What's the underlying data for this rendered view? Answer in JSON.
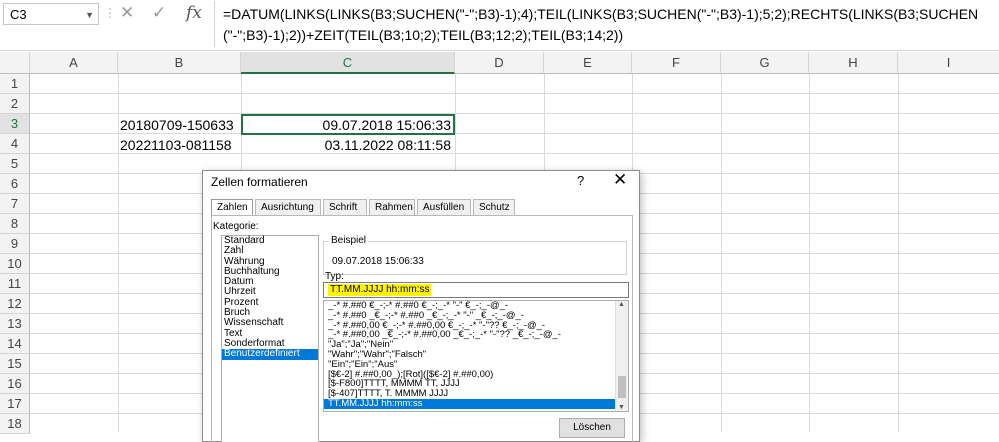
{
  "formula_bar": {
    "name_box": "C3",
    "formula": "=DATUM(LINKS(LINKS(B3;SUCHEN(\"-\";B3)-1);4);TEIL(LINKS(B3;SUCHEN(\"-\";B3)-1);5;2);RECHTS(LINKS(B3;SUCHEN(\"-\";B3)-1);2))+ZEIT(TEIL(B3;10;2);TEIL(B3;12;2);TEIL(B3;14;2))"
  },
  "columns": [
    "A",
    "B",
    "C",
    "D",
    "E",
    "F",
    "G",
    "H",
    "I"
  ],
  "rows": [
    "1",
    "2",
    "3",
    "4",
    "5",
    "6",
    "7",
    "8",
    "9",
    "10",
    "11",
    "12",
    "13",
    "14",
    "15",
    "16",
    "17",
    "18"
  ],
  "cells": {
    "B3": "20180709-150633",
    "C3": "09.07.2018 15:06:33",
    "B4": "20221103-081158",
    "C4": "03.11.2022 08:11:58"
  },
  "dialog": {
    "title": "Zellen formatieren",
    "help": "?",
    "close": "✕",
    "tabs": [
      "Zahlen",
      "Ausrichtung",
      "Schrift",
      "Rahmen",
      "Ausfüllen",
      "Schutz"
    ],
    "kategorie_label": "Kategorie:",
    "kategorien": [
      "Standard",
      "Zahl",
      "Währung",
      "Buchhaltung",
      "Datum",
      "Uhrzeit",
      "Prozent",
      "Bruch",
      "Wissenschaft",
      "Text",
      "Sonderformat",
      "Benutzerdefiniert"
    ],
    "selected_kategorie": "Benutzerdefiniert",
    "beispiel_label": "Beispiel",
    "beispiel_value": "09.07.2018 15:06:33",
    "typ_label": "Typ:",
    "typ_value": "TT.MM.JJJJ hh:mm:ss",
    "formate": [
      "_-* #.##0 €_-;-* #.##0 €_-;_-* \"-\" €_-;_-@_-",
      "_-* #.##0 _€_-;-* #.##0 _€_-;_-* \"-\" _€_-;_-@_-",
      "_-* #.##0,00 €_-;-* #.##0,00 €_-;_-* \"-\"?? €_-;_-@_-",
      "_-* #.##0,00 _€_-;-* #.##0,00 _€_-;_-* \"-\"?? _€_-;_-@_-",
      "\"Ja\";\"Ja\";\"Nein\"",
      "\"Wahr\";\"Wahr\";\"Falsch\"",
      "\"Ein\";\"Ein\";\"Aus\"",
      "[$€-2] #.##0,00_);[Rot]([$€-2] #.##0,00)",
      "[$-F800]TTTT, MMMM TT, JJJJ",
      "[$-407]TTTT, T. MMMM JJJJ",
      "TT.MM.JJJJ hh:mm:ss"
    ],
    "selected_format": "TT.MM.JJJJ hh:mm:ss",
    "delete_button": "Löschen"
  },
  "colors": {
    "excel_green": "#217346",
    "selection_blue": "#0078d7",
    "highlight_yellow": "#fff200"
  }
}
